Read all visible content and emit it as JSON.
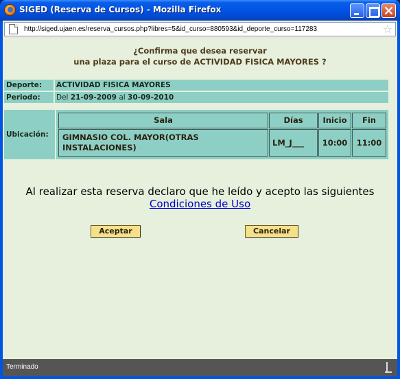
{
  "window": {
    "title": "SIGED (Reserva de Cursos) - Mozilla Firefox",
    "icon": "firefox-icon"
  },
  "urlbar": {
    "url": "http://siged.ujaen.es/reserva_cursos.php?libres=5&id_curso=880593&id_deporte_curso=117283"
  },
  "page": {
    "question_line1": "¿Confirma que desea reservar",
    "question_line2": "una plaza para el curso de ACTIVIDAD FISICA MAYORES ?",
    "deporte_label": "Deporte:",
    "deporte_value": "ACTIVIDAD FISICA MAYORES",
    "periodo_label": "Periodo:",
    "periodo_prefix": "Del",
    "periodo_start": "21-09-2009",
    "periodo_mid": "al",
    "periodo_end": "30-09-2010",
    "ubicacion_label": "Ubicación:",
    "table": {
      "headers": [
        "Sala",
        "Días",
        "Inicio",
        "Fin"
      ],
      "row": {
        "sala_line1": "GIMNASIO COL. MAYOR(OTRAS",
        "sala_line2": "INSTALACIONES)",
        "dias": "LM_J___",
        "inicio": "10:00",
        "fin": "11:00"
      }
    },
    "declaration": "Al realizar esta reserva declaro que he leído y acepto las siguientes",
    "conditions_link": "Condiciones de Uso",
    "accept_button": "Aceptar",
    "cancel_button": "Cancelar"
  },
  "statusbar": {
    "text": "Terminado"
  },
  "colors": {
    "content_bg": "#e6f0dc",
    "row_bg": "#8ecfc5",
    "button_bg": "#f6e08a",
    "question_text": "#4e3b1c",
    "link": "#0000cc"
  }
}
